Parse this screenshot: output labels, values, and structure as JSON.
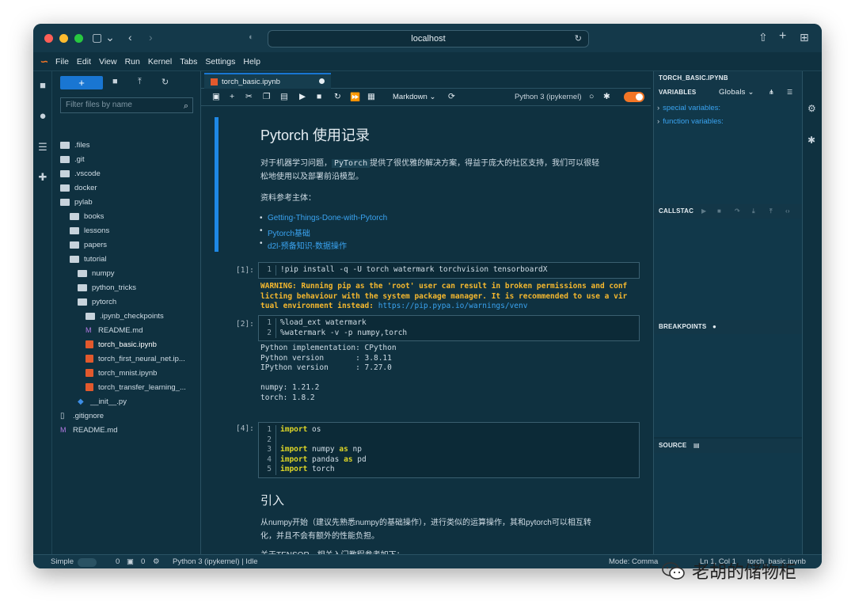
{
  "browser": {
    "url": "localhost"
  },
  "menubar": {
    "items": [
      "File",
      "Edit",
      "View",
      "Run",
      "Kernel",
      "Tabs",
      "Settings",
      "Help"
    ]
  },
  "filebrowser": {
    "new_label": "+",
    "filter_placeholder": "Filter files by name",
    "items": [
      {
        "name": ".files",
        "type": "folder",
        "depth": 0
      },
      {
        "name": ".git",
        "type": "folder",
        "depth": 0
      },
      {
        "name": ".vscode",
        "type": "folder",
        "depth": 0
      },
      {
        "name": "docker",
        "type": "folder",
        "depth": 0
      },
      {
        "name": "pylab",
        "type": "folder-open",
        "depth": 0
      },
      {
        "name": "books",
        "type": "folder",
        "depth": 1
      },
      {
        "name": "lessons",
        "type": "folder",
        "depth": 1
      },
      {
        "name": "papers",
        "type": "folder",
        "depth": 1
      },
      {
        "name": "tutorial",
        "type": "folder-open",
        "depth": 1
      },
      {
        "name": "numpy",
        "type": "folder",
        "depth": 2
      },
      {
        "name": "python_tricks",
        "type": "folder",
        "depth": 2
      },
      {
        "name": "pytorch",
        "type": "folder-open",
        "depth": 2
      },
      {
        "name": ".ipynb_checkpoints",
        "type": "folder",
        "depth": 3
      },
      {
        "name": "README.md",
        "type": "md",
        "depth": 3
      },
      {
        "name": "torch_basic.ipynb",
        "type": "nb",
        "depth": 3
      },
      {
        "name": "torch_first_neural_net.ip...",
        "type": "nb",
        "depth": 3
      },
      {
        "name": "torch_mnist.ipynb",
        "type": "nb",
        "depth": 3
      },
      {
        "name": "torch_transfer_learning_...",
        "type": "nb",
        "depth": 3
      },
      {
        "name": "__init__.py",
        "type": "py",
        "depth": 2
      },
      {
        "name": ".gitignore",
        "type": "gi",
        "depth": 0
      },
      {
        "name": "README.md",
        "type": "md",
        "depth": 0
      }
    ]
  },
  "notebook": {
    "tab_title": "torch_basic.ipynb",
    "cell_type": "Markdown",
    "kernel": "Python 3 (ipykernel)",
    "title": "Pytorch 使用记录",
    "intro_before": "对于机器学习问题，",
    "intro_code": "PyTorch",
    "intro_after": "提供了很优雅的解决方案，得益于庞大的社区支持，我们可以很轻",
    "intro_line2": "松地使用以及部署前沿模型。",
    "refs_label": "资料参考主体：",
    "links": [
      "Getting-Things-Done-with-Pytorch",
      "Pytorch基础",
      "d2l-预备知识-数据操作"
    ],
    "cell1": {
      "prompt": "[1]:",
      "lines": [
        {
          "n": "1",
          "code": "!pip install -q -U torch watermark torchvision tensorboardX"
        }
      ]
    },
    "cell1_out": [
      "WARNING: Running pip as the 'root' user can result in broken permissions and conf",
      "licting behaviour with the system package manager. It is recommended to use a vir",
      "tual environment instead: "
    ],
    "cell1_out_link": "https://pip.pypa.io/warnings/venv",
    "cell2": {
      "prompt": "[2]:",
      "lines": [
        {
          "n": "1",
          "code": "%load_ext watermark"
        },
        {
          "n": "2",
          "code": "%watermark -v -p numpy,torch"
        }
      ]
    },
    "cell2_out": [
      "Python implementation: CPython",
      "Python version       : 3.8.11",
      "IPython version      : 7.27.0",
      "",
      "numpy: 1.21.2",
      "torch: 1.8.2"
    ],
    "cell4": {
      "prompt": "[4]:",
      "lines": [
        {
          "n": "1",
          "kw": "import",
          "rest": " os"
        },
        {
          "n": "2",
          "kw": "",
          "rest": ""
        },
        {
          "n": "3",
          "kw": "import",
          "rest": " numpy ",
          "kw2": "as",
          "rest2": " np"
        },
        {
          "n": "4",
          "kw": "import",
          "rest": " pandas ",
          "kw2": "as",
          "rest2": " pd"
        },
        {
          "n": "5",
          "kw": "import",
          "rest": " torch"
        }
      ]
    },
    "h2": "引入",
    "para2_line1": "从numpy开始（建议先熟悉numpy的基础操作），进行类似的运算操作，其和pytorch可以相互转",
    "para2_line2": "化，并且不会有额外的性能负担。",
    "para3": "关于TENSOR，相关入门教程参考如下："
  },
  "debugger": {
    "file": "TORCH_BASIC.IPYNB",
    "variables_label": "VARIABLES",
    "scope": "Globals",
    "variables": [
      "special variables:",
      "function variables:"
    ],
    "callstack_label": "CALLSTAC",
    "breakpoints_label": "BREAKPOINTS",
    "source_label": "SOURCE"
  },
  "statusbar": {
    "mode_label": "Simple",
    "count1": "0",
    "count2": "0",
    "kernel_status": "Python 3 (ipykernel) | Idle",
    "mode": "Mode: Comma",
    "position": "Ln 1, Col 1",
    "file": "torch_basic.ipynb"
  },
  "watermark": {
    "text": "老胡的储物柜"
  },
  "colors": {
    "accent": "#1976d2",
    "kernel_toggle": "#f37626",
    "warning": "#f5b82e",
    "link": "#3aa3f0"
  }
}
